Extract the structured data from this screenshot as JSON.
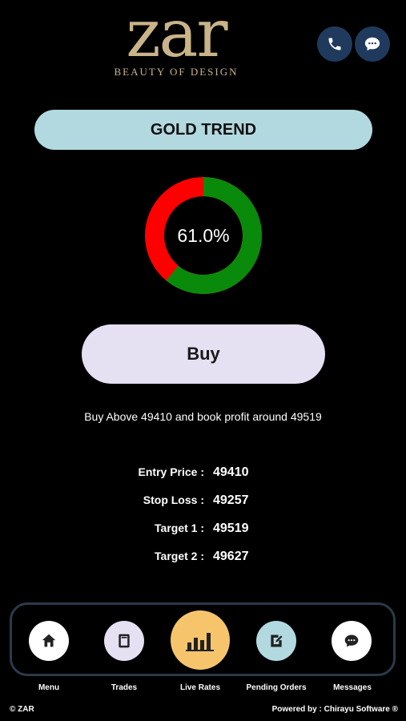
{
  "brand": {
    "logo_text": "zar",
    "tagline": "BEAUTY OF DESIGN"
  },
  "header": {
    "phone_icon": "phone-icon",
    "chat_icon": "chat-icon"
  },
  "trend": {
    "title": "GOLD TREND",
    "percent_label": "61.0%",
    "percent": 61.0,
    "colors": {
      "positive": "#0a8a0a",
      "negative": "#ff0000"
    }
  },
  "signal": {
    "button_label": "Buy",
    "advice": "Buy Above 49410 and book profit around 49519"
  },
  "levels": [
    {
      "label": "Entry Price :",
      "value": "49410"
    },
    {
      "label": "Stop Loss :",
      "value": "49257"
    },
    {
      "label": "Target 1 :",
      "value": "49519"
    },
    {
      "label": "Target 2 :",
      "value": "49627"
    }
  ],
  "nav": [
    {
      "label": "Menu",
      "icon": "home-icon",
      "bg": "#ffffff"
    },
    {
      "label": "Trades",
      "icon": "book-icon",
      "bg": "#e6e0f3"
    },
    {
      "label": "Live Rates",
      "icon": "bar-chart-icon",
      "bg": "#f6c56b"
    },
    {
      "label": "Pending Orders",
      "icon": "edit-icon",
      "bg": "#b2d9e0"
    },
    {
      "label": "Messages",
      "icon": "chat-icon",
      "bg": "#ffffff"
    }
  ],
  "footer": {
    "copyright": "© ZAR",
    "powered_by": "Powered by : Chirayu Software ®"
  }
}
